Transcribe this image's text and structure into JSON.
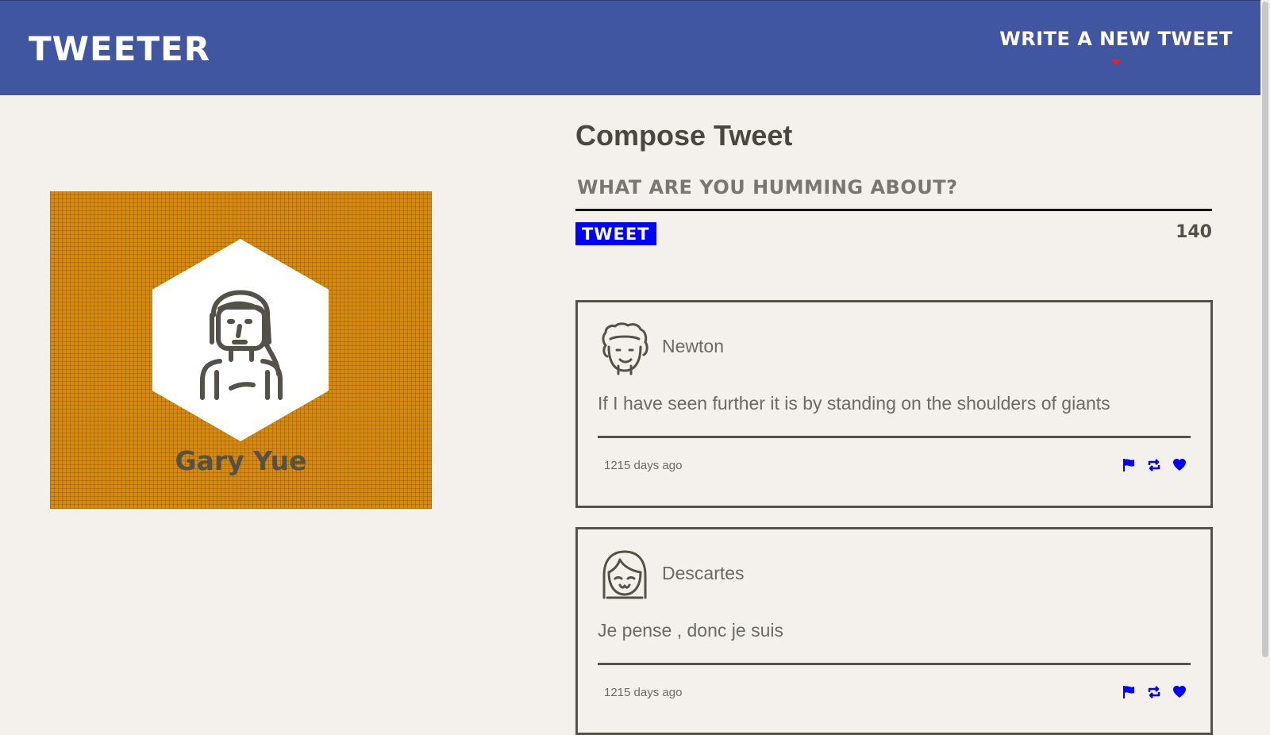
{
  "header": {
    "brand": "Tweeter",
    "compose_toggle": "Write a new tweet"
  },
  "profile": {
    "name": "Gary Yue"
  },
  "compose": {
    "title": "Compose Tweet",
    "placeholder": "What are you humming about?",
    "button_label": "Tweet",
    "char_count": "140"
  },
  "tweets": [
    {
      "author": "Newton",
      "text": "If I have seen further it is by standing on the shoulders of giants",
      "time": "1215 days ago"
    },
    {
      "author": "Descartes",
      "text": "Je pense , donc je suis",
      "time": "1215 days ago"
    }
  ],
  "colors": {
    "header": "#4056a1",
    "page_background": "#f4f1ec",
    "accent_blue": "#0000ff",
    "caret_red": "#ff1a1a",
    "profile_card": "#d68b0f",
    "text_dark": "#545149"
  },
  "icons": {
    "flag": "flag-icon",
    "retweet": "retweet-icon",
    "like": "heart-icon"
  }
}
